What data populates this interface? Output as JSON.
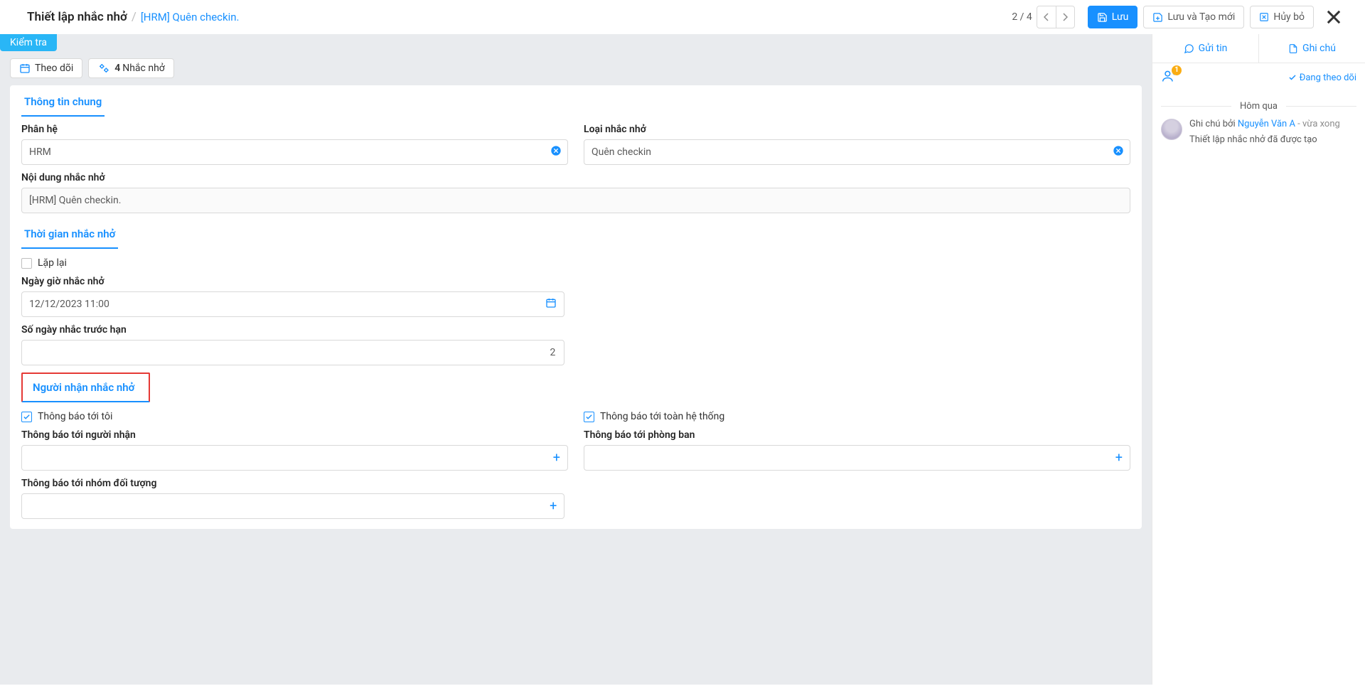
{
  "breadcrumb": {
    "root": "Thiết lập nhắc nhở",
    "current": "[HRM] Quên checkin."
  },
  "pager": {
    "text": "2 / 4"
  },
  "actions": {
    "save": "Lưu",
    "save_new": "Lưu và Tạo mới",
    "cancel": "Hủy bỏ"
  },
  "check_badge": "Kiểm tra",
  "follow_btn": "Theo dõi",
  "remind_btn": {
    "count": "4",
    "label": "Nhắc nhở"
  },
  "sections": {
    "general": "Thông tin chung",
    "time": "Thời gian nhắc nhở",
    "recipients": "Người nhận nhắc nhở"
  },
  "fields": {
    "subsystem": {
      "label": "Phân hệ",
      "value": "HRM"
    },
    "type": {
      "label": "Loại nhắc nhở",
      "value": "Quên checkin"
    },
    "content": {
      "label": "Nội dung nhắc nhở",
      "value": "[HRM] Quên checkin."
    },
    "repeat": {
      "label": "Lặp lại",
      "checked": false
    },
    "datetime": {
      "label": "Ngày giờ nhắc nhở",
      "value": "12/12/2023 11:00"
    },
    "days_before": {
      "label": "Số ngày nhắc trước hạn",
      "value": "2"
    },
    "notify_me": {
      "label": "Thông báo tới tôi",
      "checked": true
    },
    "notify_all": {
      "label": "Thông báo tới toàn hệ thống",
      "checked": true
    },
    "notify_recipient": {
      "label": "Thông báo tới người nhận"
    },
    "notify_dept": {
      "label": "Thông báo tới phòng ban"
    },
    "notify_group": {
      "label": "Thông báo tới nhóm đối tượng"
    }
  },
  "side": {
    "tab_send": "Gửi tin",
    "tab_note": "Ghi chú",
    "follower_badge": "1",
    "following": "Đang theo dõi",
    "day": "Hôm qua",
    "note_prefix": "Ghi chú bởi ",
    "note_author": "Nguyễn Văn A",
    "note_when": " - vừa xong",
    "note_body": "Thiết lập nhắc nhở đã được tạo"
  }
}
